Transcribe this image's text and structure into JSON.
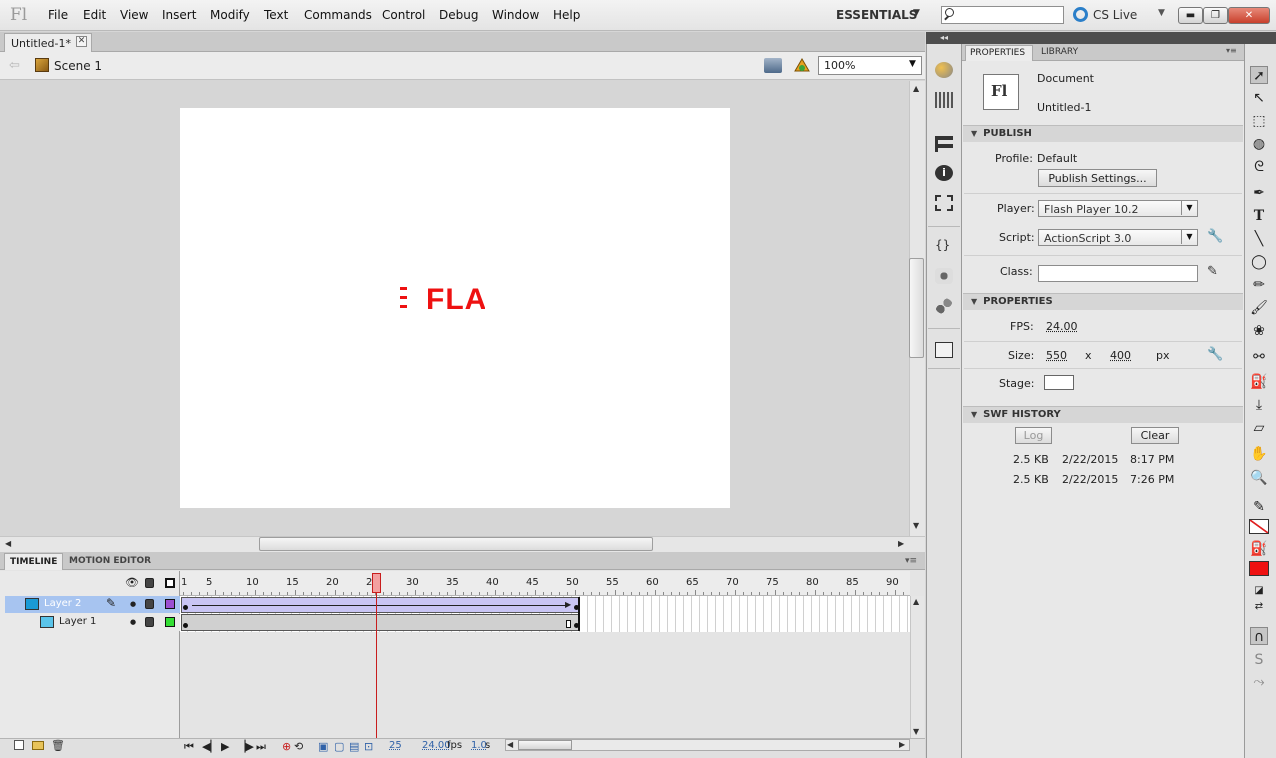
{
  "app": {
    "logo": "Fl"
  },
  "menu": [
    "File",
    "Edit",
    "View",
    "Insert",
    "Modify",
    "Text",
    "Commands",
    "Control",
    "Debug",
    "Window",
    "Help"
  ],
  "workspace": {
    "label": "ESSENTIALS",
    "arrow": "▼"
  },
  "search": {
    "placeholder": ""
  },
  "cslive": {
    "label": "CS Live",
    "arrow": "▼"
  },
  "window_controls": {
    "minimize": "▬",
    "restore": "❐",
    "close": "✕"
  },
  "document": {
    "tab_label": "Untitled-1*",
    "tab_close": "✕"
  },
  "editbar": {
    "back": "⇦",
    "scene": "Scene 1",
    "zoom": "100%",
    "zoom_arrow": "▼"
  },
  "stage": {
    "text_fragment": "FLA",
    "text_color": "#ee1111",
    "background": "#ffffff"
  },
  "timeline": {
    "tabs": {
      "timeline": "TIMELINE",
      "motion_editor": "MOTION EDITOR"
    },
    "frame_numbers": [
      "1",
      "5",
      "10",
      "15",
      "20",
      "25",
      "30",
      "35",
      "40",
      "45",
      "50",
      "55",
      "60",
      "65",
      "70",
      "75",
      "80",
      "85",
      "90"
    ],
    "layers": [
      {
        "name": "Layer 2",
        "color": "#9b4fd0",
        "selected": true
      },
      {
        "name": "Layer 1",
        "color": "#33dd33",
        "selected": false
      }
    ],
    "current_frame": "25",
    "fps": "24.00",
    "fps_unit": "fps",
    "elapsed": "1.0",
    "elapsed_unit": "s",
    "menu_icon": "▾≡"
  },
  "properties": {
    "tabs": {
      "properties": "PROPERTIES",
      "library": "LIBRARY"
    },
    "doc_icon": "Fl",
    "doc_type": "Document",
    "doc_name": "Untitled-1",
    "publish": {
      "header": "PUBLISH",
      "profile_label": "Profile:",
      "profile_value": "Default",
      "settings_button": "Publish Settings...",
      "player_label": "Player:",
      "player_value": "Flash Player 10.2",
      "script_label": "Script:",
      "script_value": "ActionScript 3.0",
      "class_label": "Class:",
      "class_value": ""
    },
    "props": {
      "header": "PROPERTIES",
      "fps_label": "FPS:",
      "fps_value": "24.00",
      "size_label": "Size:",
      "width": "550",
      "x": "x",
      "height": "400",
      "unit": "px",
      "stage_label": "Stage:",
      "stage_color": "#ffffff"
    },
    "swf_history": {
      "header": "SWF HISTORY",
      "log_button": "Log",
      "clear_button": "Clear",
      "entries": [
        {
          "size": "2.5 KB",
          "date": "2/22/2015",
          "time": "8:17 PM"
        },
        {
          "size": "2.5 KB",
          "date": "2/22/2015",
          "time": "7:26 PM"
        }
      ]
    }
  },
  "panel_collapse": "◂◂",
  "tools_collapse": "▸▸",
  "colors": {
    "stroke": "#000000",
    "fill": "#ee1111",
    "accent_selection": "#a7c4f0",
    "playhead": "#c81d1d"
  },
  "tools": [
    "selection-tool",
    "subselection-tool",
    "free-transform-tool",
    "3d-rotation-tool",
    "lasso-tool",
    "pen-tool",
    "text-tool",
    "line-tool",
    "oval-tool",
    "pencil-tool",
    "brush-tool",
    "deco-tool",
    "bone-tool",
    "paint-bucket-tool",
    "eyedropper-tool",
    "eraser-tool",
    "hand-tool",
    "zoom-tool"
  ]
}
